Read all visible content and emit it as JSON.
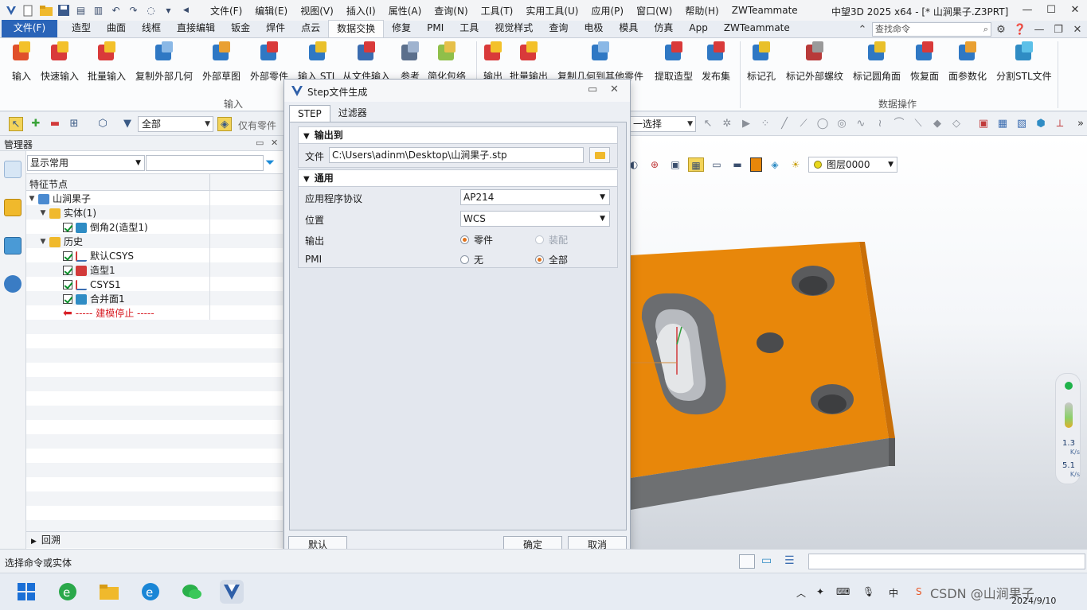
{
  "titlebar": {
    "menus": [
      "文件(F)",
      "编辑(E)",
      "视图(V)",
      "插入(I)",
      "属性(A)",
      "查询(N)",
      "工具(T)",
      "实用工具(U)",
      "应用(P)",
      "窗口(W)",
      "帮助(H)",
      "ZWTeammate"
    ],
    "app_title": "中望3D 2025 x64 - [* 山涧果子.Z3PRT]"
  },
  "ribbon_tabs": {
    "items": [
      "文件(F)",
      "造型",
      "曲面",
      "线框",
      "直接编辑",
      "钣金",
      "焊件",
      "点云",
      "数据交换",
      "修复",
      "PMI",
      "工具",
      "视觉样式",
      "查询",
      "电极",
      "模具",
      "仿真",
      "App",
      "ZWTeammate"
    ],
    "active": "数据交换",
    "search_placeholder": "查找命令"
  },
  "ribbon": {
    "buttons": [
      "输入",
      "快速输入",
      "批量输入",
      "复制外部几何",
      "外部草图",
      "外部零件",
      "输入 STL",
      "从文件输入",
      "参考",
      "简化包络",
      "输出",
      "批量输出",
      "复制几何到其他零件",
      "提取造型",
      "发布集",
      "标记孔",
      "标记外部螺纹",
      "标记圆角面",
      "恢复面",
      "面参数化",
      "分割STL文件"
    ],
    "group_input": "输入",
    "group_data_ops": "数据操作"
  },
  "toolbar2": {
    "filter_value": "全部",
    "only_parts": "仅有零件",
    "select_value": "一选择"
  },
  "manager": {
    "title": "管理器",
    "combo_value": "显示常用",
    "col_header": "特征节点",
    "tree": {
      "root": "山涧果子",
      "solid": "实体(1)",
      "chamfer": "倒角2(造型1)",
      "history": "历史",
      "csys_default": "默认CSYS",
      "model1": "造型1",
      "csys1": "CSYS1",
      "merge1": "合并面1",
      "stop": "----- 建模停止 -----"
    },
    "rollback": "回溯"
  },
  "viewport": {
    "layer": "图层0000",
    "fps_top": "1.3",
    "fps_top_unit": "K/s",
    "fps_bottom": "5.1",
    "fps_bottom_unit": "K/s"
  },
  "dialog": {
    "title": "Step文件生成",
    "tabs": [
      "STEP",
      "过滤器"
    ],
    "output_to": "输出到",
    "file_label": "文件",
    "file_value": "C:\\Users\\adinm\\Desktop\\山涧果子.stp",
    "general": "通用",
    "protocol_label": "应用程序协议",
    "protocol_value": "AP214",
    "position_label": "位置",
    "position_value": "WCS",
    "output_label": "输出",
    "output_part": "零件",
    "output_assembly": "装配",
    "pmi_label": "PMI",
    "pmi_none": "无",
    "pmi_all": "全部",
    "btn_default": "默认",
    "btn_ok": "确定",
    "btn_cancel": "取消"
  },
  "statusbar": {
    "message": "选择命令或实体"
  },
  "taskbar": {
    "tray_text": "CSDN @山涧果子",
    "date": "2024/9/10"
  },
  "colors": {
    "accent": "#2a64b8",
    "part_orange": "#e8870a",
    "part_side": "#707274",
    "stop_red": "#d81f26"
  }
}
